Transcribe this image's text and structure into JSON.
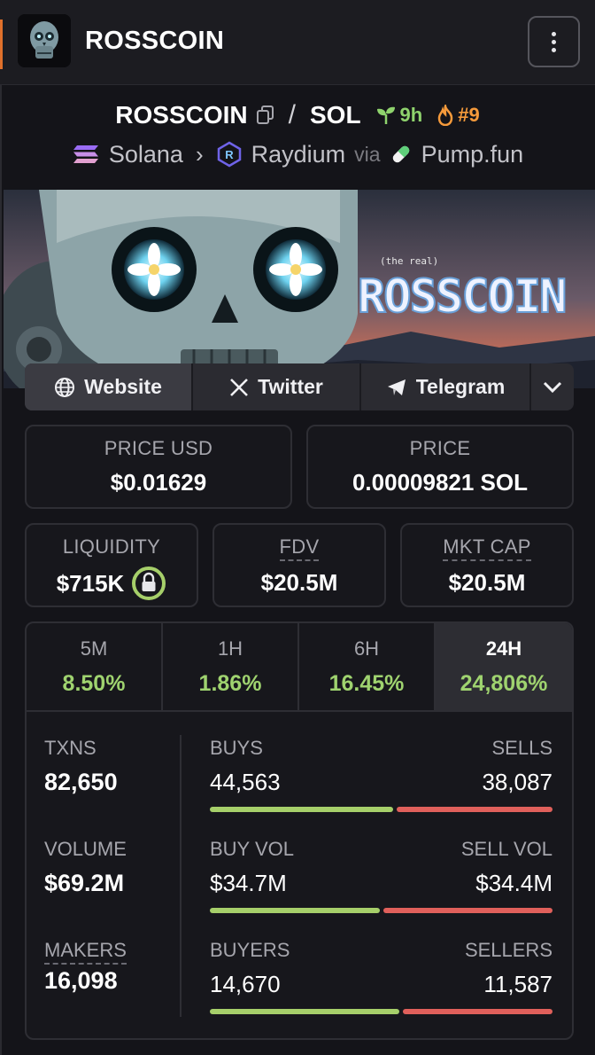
{
  "header": {
    "title": "ROSSCOIN",
    "menu_icon": "kebab-menu-icon",
    "accent": "#e0702b"
  },
  "pair": {
    "base": "ROSSCOIN",
    "separator": "/",
    "quote": "SOL",
    "age": "9h",
    "rank": "#9",
    "age_color": "#8fd36d",
    "rank_color": "#f59a3b"
  },
  "chain": {
    "network": "Solana",
    "dex": "Raydium",
    "via": "via",
    "launchpad": "Pump.fun"
  },
  "banner": {
    "small_text": "(the real)",
    "big_text": "ROSSCOIN"
  },
  "links": {
    "website": "Website",
    "twitter": "Twitter",
    "telegram": "Telegram"
  },
  "price": {
    "usd_label": "PRICE USD",
    "usd_value": "$0.01629",
    "native_label": "PRICE",
    "native_value": "0.00009821 SOL"
  },
  "metrics": {
    "liquidity_label": "LIQUIDITY",
    "liquidity_value": "$715K",
    "fdv_label": "FDV",
    "fdv_value": "$20.5M",
    "mcap_label": "MKT CAP",
    "mcap_value": "$20.5M"
  },
  "timeframes": [
    {
      "label": "5M",
      "change": "8.50%"
    },
    {
      "label": "1H",
      "change": "1.86%"
    },
    {
      "label": "6H",
      "change": "16.45%"
    },
    {
      "label": "24H",
      "change": "24,806%"
    }
  ],
  "activity": {
    "txns_label": "TXNS",
    "txns_value": "82,650",
    "volume_label": "VOLUME",
    "volume_value": "$69.2M",
    "makers_label": "MAKERS",
    "makers_value": "16,098",
    "buys_label": "BUYS",
    "buys_value": "44,563",
    "sells_label": "SELLS",
    "sells_value": "38,087",
    "buy_vol_label": "BUY VOL",
    "buy_vol_value": "$34.7M",
    "sell_vol_label": "SELL VOL",
    "sell_vol_value": "$34.4M",
    "buyers_label": "BUYERS",
    "buyers_value": "14,670",
    "sellers_label": "SELLERS",
    "sellers_value": "11,587",
    "buy_share_txns": 0.539,
    "buy_share_vol": 0.502,
    "buy_share_makers": 0.559,
    "buy_color": "#a6cf6a",
    "sell_color": "#e0605b",
    "positive_color": "#9fd36f"
  }
}
